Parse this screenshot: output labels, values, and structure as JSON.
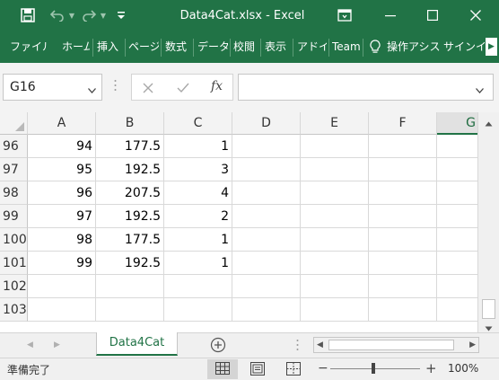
{
  "window": {
    "title": "Data4Cat.xlsx - Excel"
  },
  "ribbon": {
    "tabs": [
      "ファイル",
      "ホーム",
      "挿入",
      "ページ",
      "数式",
      "データ",
      "校閲",
      "表示",
      "アドイ",
      "Team"
    ],
    "tell_me": "操作アシス",
    "signin": "サインイン"
  },
  "formula_bar": {
    "name_box": "G16",
    "fx_label": "fx",
    "formula": ""
  },
  "grid": {
    "columns": [
      "A",
      "B",
      "C",
      "D",
      "E",
      "F",
      "G"
    ],
    "selected_column": "G",
    "rows": [
      {
        "row": "96",
        "cells": [
          "94",
          "177.5",
          "1"
        ]
      },
      {
        "row": "97",
        "cells": [
          "95",
          "192.5",
          "3"
        ]
      },
      {
        "row": "98",
        "cells": [
          "96",
          "207.5",
          "4"
        ]
      },
      {
        "row": "99",
        "cells": [
          "97",
          "192.5",
          "2"
        ]
      },
      {
        "row": "100",
        "cells": [
          "98",
          "177.5",
          "1"
        ]
      },
      {
        "row": "101",
        "cells": [
          "99",
          "192.5",
          "1"
        ]
      },
      {
        "row": "102",
        "cells": [
          "",
          "",
          ""
        ]
      },
      {
        "row": "103",
        "cells": [
          "",
          "",
          ""
        ]
      }
    ]
  },
  "sheets": {
    "active": "Data4Cat"
  },
  "status": {
    "ready": "準備完了",
    "zoom": "100%"
  },
  "colors": {
    "accent": "#217346"
  }
}
